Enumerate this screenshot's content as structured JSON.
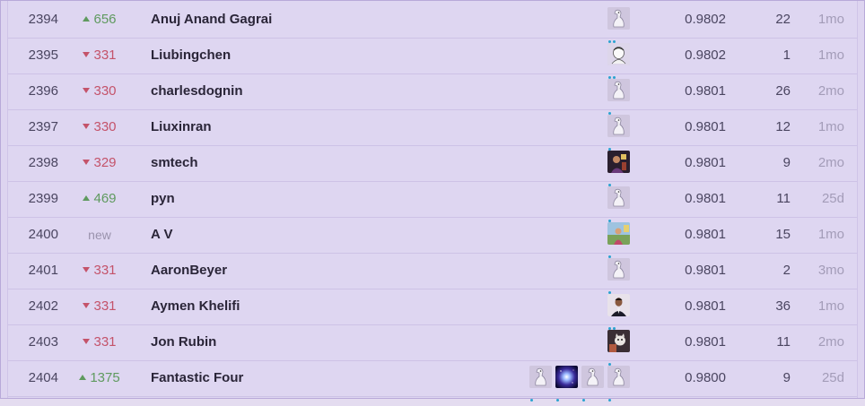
{
  "leaderboard": {
    "rows": [
      {
        "rank": "2394",
        "change": "656",
        "direction": "up",
        "team": "Anuj Anand Gagrai",
        "avatars": [
          "goose"
        ],
        "tier_dots": 2,
        "score": "0.9802",
        "entries": "22",
        "last": "1mo"
      },
      {
        "rank": "2395",
        "change": "331",
        "direction": "down",
        "team": "Liubingchen",
        "avatars": [
          "sketch"
        ],
        "tier_dots": 2,
        "score": "0.9802",
        "entries": "1",
        "last": "1mo"
      },
      {
        "rank": "2396",
        "change": "330",
        "direction": "down",
        "team": "charlesdognin",
        "avatars": [
          "goose"
        ],
        "tier_dots": 1,
        "score": "0.9801",
        "entries": "26",
        "last": "2mo"
      },
      {
        "rank": "2397",
        "change": "330",
        "direction": "down",
        "team": "Liuxinran",
        "avatars": [
          "goose"
        ],
        "tier_dots": 1,
        "score": "0.9801",
        "entries": "12",
        "last": "1mo"
      },
      {
        "rank": "2398",
        "change": "329",
        "direction": "down",
        "team": "smtech",
        "avatars": [
          "photo-dark"
        ],
        "tier_dots": 1,
        "score": "0.9801",
        "entries": "9",
        "last": "2mo"
      },
      {
        "rank": "2399",
        "change": "469",
        "direction": "up",
        "team": "pyn",
        "avatars": [
          "goose"
        ],
        "tier_dots": 1,
        "score": "0.9801",
        "entries": "11",
        "last": "25d"
      },
      {
        "rank": "2400",
        "change": "new",
        "direction": "new",
        "team": "A V",
        "avatars": [
          "photo-outdoor"
        ],
        "tier_dots": 1,
        "score": "0.9801",
        "entries": "15",
        "last": "1mo"
      },
      {
        "rank": "2401",
        "change": "331",
        "direction": "down",
        "team": "AaronBeyer",
        "avatars": [
          "goose"
        ],
        "tier_dots": 1,
        "score": "0.9801",
        "entries": "2",
        "last": "3mo"
      },
      {
        "rank": "2402",
        "change": "331",
        "direction": "down",
        "team": "Aymen Khelifi",
        "avatars": [
          "photo-portrait"
        ],
        "tier_dots": 2,
        "score": "0.9801",
        "entries": "36",
        "last": "1mo"
      },
      {
        "rank": "2403",
        "change": "331",
        "direction": "down",
        "team": "Jon Rubin",
        "avatars": [
          "photo-cat"
        ],
        "tier_dots": 1,
        "score": "0.9801",
        "entries": "11",
        "last": "2mo"
      },
      {
        "rank": "2404",
        "change": "1375",
        "direction": "up",
        "team": "Fantastic Four",
        "avatars": [
          "goose",
          "galaxy",
          "goose",
          "goose"
        ],
        "tier_dots": 1,
        "score": "0.9800",
        "entries": "9",
        "last": "25d"
      }
    ]
  }
}
